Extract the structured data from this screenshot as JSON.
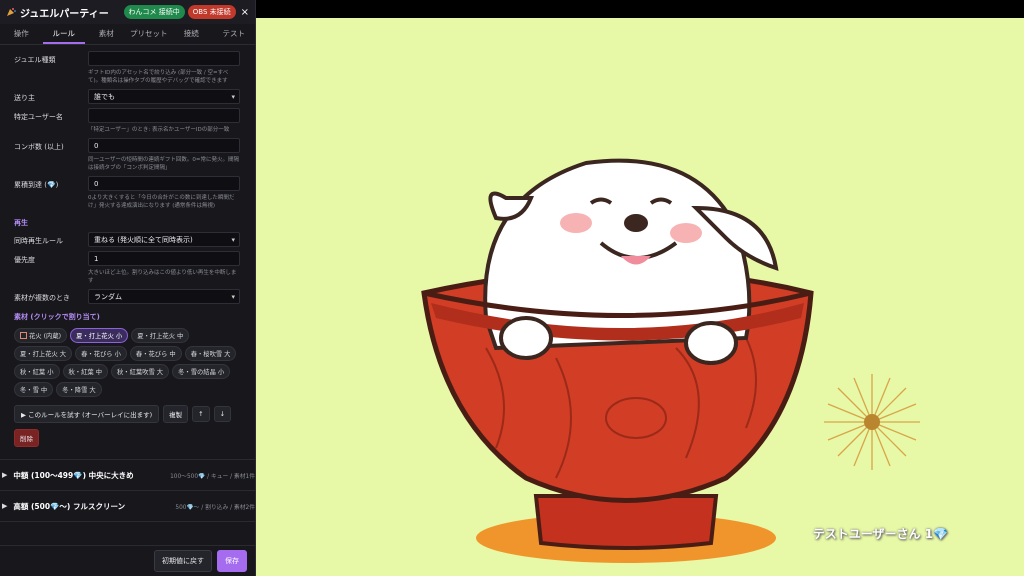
{
  "app": {
    "title": "ジュエルパーティー",
    "badge_wancome": "わんコメ 接続中",
    "badge_obs": "OBS 未接続",
    "close": "×"
  },
  "tabs": [
    "操作",
    "ルール",
    "素材",
    "プリセット",
    "接続",
    "テスト"
  ],
  "form": {
    "jewel_type_label": "ジュエル種類",
    "jewel_type_value": "",
    "jewel_type_hint": "ギフトID内のアセット名で絞り込み (部分一致 / 空=すべて)。種類名は操作タブの履歴やデバッグで確認できます",
    "sender_label": "送り主",
    "sender_value": "誰でも",
    "specific_user_label": "特定ユーザー名",
    "specific_user_value": "",
    "specific_user_hint": "「特定ユーザー」のとき: 表示名かユーザーIDの部分一致",
    "combo_label": "コンボ数 (以上)",
    "combo_value": "0",
    "combo_hint": "同一ユーザーの短時間の連続ギフト回数。0=常に発火。間隔は接続タブの「コンボ判定間隔」",
    "cumulative_label": "累積到達 (💎)",
    "cumulative_value": "0",
    "cumulative_hint": "0より大きくすると「今日の合計がこの数に到達した瞬間だけ」発火する達成演出になります (通常条件は無視)"
  },
  "playback": {
    "section": "再生",
    "concurrent_label": "同時再生ルール",
    "concurrent_value": "重ねる (発火順に全て同時表示)",
    "priority_label": "優先度",
    "priority_value": "1",
    "priority_hint": "大きいほど上位。割り込みはこの値より低い再生を中断します",
    "multiple_label": "素材が複数のとき",
    "multiple_value": "ランダム"
  },
  "assets": {
    "section": "素材 (クリックで割り当て)",
    "chips": [
      "花火 (内蔵)",
      "夏・打上花火 小",
      "夏・打上花火 中",
      "夏・打上花火 大",
      "春・花びら 小",
      "春・花びら 中",
      "春・桜吹雪 大",
      "秋・紅葉 小",
      "秋・紅葉 中",
      "秋・紅葉吹雪 大",
      "冬・雪の結晶 小",
      "冬・雪 中",
      "冬・降雪 大"
    ],
    "selected_index": 1
  },
  "actions": {
    "test": "▶ このルールを試す (オーバーレイに出ます)",
    "duplicate": "複製",
    "up": "↑",
    "down": "↓",
    "delete": "削除"
  },
  "rules": [
    {
      "title": "中額 (100〜499💎) 中央に大きめ",
      "meta": "100〜500💎 / キュー / 素材1件"
    },
    {
      "title": "高額 (500💎〜) フルスクリーン",
      "meta": "500💎〜 / 割り込み / 素材2件"
    }
  ],
  "footer": {
    "reset": "初期値に戻す",
    "save": "保存"
  },
  "overlay": {
    "toast_user": "テストユーザーさん",
    "toast_count": "1",
    "toast_gem": "💎"
  },
  "colors": {
    "accent": "#a56cf0",
    "connected": "#1f8a4c",
    "disconnected": "#c0392b",
    "preview_bg": "#e7f8a6"
  }
}
